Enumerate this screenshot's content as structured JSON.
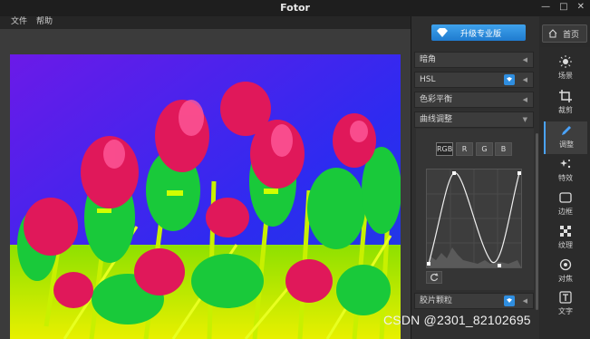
{
  "window": {
    "title": "Fotor",
    "controls": [
      "—",
      "□",
      "✕"
    ]
  },
  "menu": [
    "文件",
    "帮助"
  ],
  "upgrade_label": "升级专业版",
  "home_label": "首页",
  "panel_sections": [
    {
      "label": "暗角"
    },
    {
      "label": "HSL"
    },
    {
      "label": "色彩平衡"
    },
    {
      "label": "曲线调整"
    }
  ],
  "channels": [
    "RGB",
    "R",
    "G",
    "B"
  ],
  "bottom_section": {
    "label": "胶片颗粒"
  },
  "tools": [
    {
      "label": "场景",
      "icon": "sun-icon"
    },
    {
      "label": "裁剪",
      "icon": "crop-icon"
    },
    {
      "label": "调整",
      "icon": "pencil-icon"
    },
    {
      "label": "特效",
      "icon": "sparkle-icon"
    },
    {
      "label": "边框",
      "icon": "frame-icon"
    },
    {
      "label": "纹理",
      "icon": "texture-icon"
    },
    {
      "label": "对焦",
      "icon": "focus-icon"
    },
    {
      "label": "文字",
      "icon": "text-icon"
    }
  ],
  "watermark": "CSDN @2301_82102695",
  "colors": {
    "accent": "#2f8ee0",
    "panel": "#2f2f2f",
    "photo_sky": "#5a16e8"
  }
}
